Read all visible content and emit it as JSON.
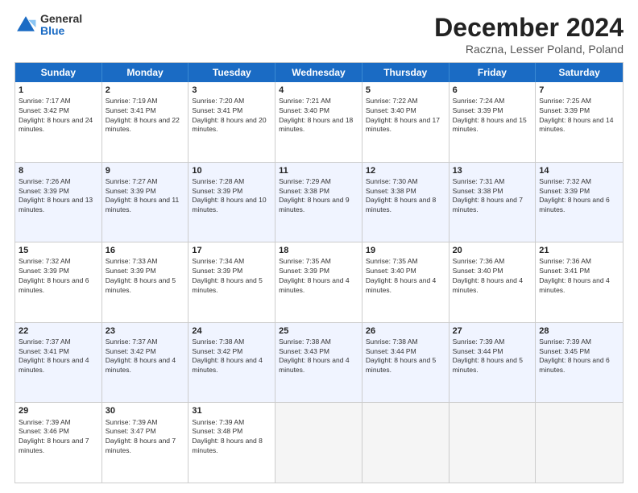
{
  "header": {
    "logo_general": "General",
    "logo_blue": "Blue",
    "main_title": "December 2024",
    "subtitle": "Raczna, Lesser Poland, Poland"
  },
  "calendar": {
    "days_of_week": [
      "Sunday",
      "Monday",
      "Tuesday",
      "Wednesday",
      "Thursday",
      "Friday",
      "Saturday"
    ],
    "rows": [
      [
        {
          "day": "1",
          "sunrise": "Sunrise: 7:17 AM",
          "sunset": "Sunset: 3:42 PM",
          "daylight": "Daylight: 8 hours and 24 minutes."
        },
        {
          "day": "2",
          "sunrise": "Sunrise: 7:19 AM",
          "sunset": "Sunset: 3:41 PM",
          "daylight": "Daylight: 8 hours and 22 minutes."
        },
        {
          "day": "3",
          "sunrise": "Sunrise: 7:20 AM",
          "sunset": "Sunset: 3:41 PM",
          "daylight": "Daylight: 8 hours and 20 minutes."
        },
        {
          "day": "4",
          "sunrise": "Sunrise: 7:21 AM",
          "sunset": "Sunset: 3:40 PM",
          "daylight": "Daylight: 8 hours and 18 minutes."
        },
        {
          "day": "5",
          "sunrise": "Sunrise: 7:22 AM",
          "sunset": "Sunset: 3:40 PM",
          "daylight": "Daylight: 8 hours and 17 minutes."
        },
        {
          "day": "6",
          "sunrise": "Sunrise: 7:24 AM",
          "sunset": "Sunset: 3:39 PM",
          "daylight": "Daylight: 8 hours and 15 minutes."
        },
        {
          "day": "7",
          "sunrise": "Sunrise: 7:25 AM",
          "sunset": "Sunset: 3:39 PM",
          "daylight": "Daylight: 8 hours and 14 minutes."
        }
      ],
      [
        {
          "day": "8",
          "sunrise": "Sunrise: 7:26 AM",
          "sunset": "Sunset: 3:39 PM",
          "daylight": "Daylight: 8 hours and 13 minutes."
        },
        {
          "day": "9",
          "sunrise": "Sunrise: 7:27 AM",
          "sunset": "Sunset: 3:39 PM",
          "daylight": "Daylight: 8 hours and 11 minutes."
        },
        {
          "day": "10",
          "sunrise": "Sunrise: 7:28 AM",
          "sunset": "Sunset: 3:39 PM",
          "daylight": "Daylight: 8 hours and 10 minutes."
        },
        {
          "day": "11",
          "sunrise": "Sunrise: 7:29 AM",
          "sunset": "Sunset: 3:38 PM",
          "daylight": "Daylight: 8 hours and 9 minutes."
        },
        {
          "day": "12",
          "sunrise": "Sunrise: 7:30 AM",
          "sunset": "Sunset: 3:38 PM",
          "daylight": "Daylight: 8 hours and 8 minutes."
        },
        {
          "day": "13",
          "sunrise": "Sunrise: 7:31 AM",
          "sunset": "Sunset: 3:38 PM",
          "daylight": "Daylight: 8 hours and 7 minutes."
        },
        {
          "day": "14",
          "sunrise": "Sunrise: 7:32 AM",
          "sunset": "Sunset: 3:39 PM",
          "daylight": "Daylight: 8 hours and 6 minutes."
        }
      ],
      [
        {
          "day": "15",
          "sunrise": "Sunrise: 7:32 AM",
          "sunset": "Sunset: 3:39 PM",
          "daylight": "Daylight: 8 hours and 6 minutes."
        },
        {
          "day": "16",
          "sunrise": "Sunrise: 7:33 AM",
          "sunset": "Sunset: 3:39 PM",
          "daylight": "Daylight: 8 hours and 5 minutes."
        },
        {
          "day": "17",
          "sunrise": "Sunrise: 7:34 AM",
          "sunset": "Sunset: 3:39 PM",
          "daylight": "Daylight: 8 hours and 5 minutes."
        },
        {
          "day": "18",
          "sunrise": "Sunrise: 7:35 AM",
          "sunset": "Sunset: 3:39 PM",
          "daylight": "Daylight: 8 hours and 4 minutes."
        },
        {
          "day": "19",
          "sunrise": "Sunrise: 7:35 AM",
          "sunset": "Sunset: 3:40 PM",
          "daylight": "Daylight: 8 hours and 4 minutes."
        },
        {
          "day": "20",
          "sunrise": "Sunrise: 7:36 AM",
          "sunset": "Sunset: 3:40 PM",
          "daylight": "Daylight: 8 hours and 4 minutes."
        },
        {
          "day": "21",
          "sunrise": "Sunrise: 7:36 AM",
          "sunset": "Sunset: 3:41 PM",
          "daylight": "Daylight: 8 hours and 4 minutes."
        }
      ],
      [
        {
          "day": "22",
          "sunrise": "Sunrise: 7:37 AM",
          "sunset": "Sunset: 3:41 PM",
          "daylight": "Daylight: 8 hours and 4 minutes."
        },
        {
          "day": "23",
          "sunrise": "Sunrise: 7:37 AM",
          "sunset": "Sunset: 3:42 PM",
          "daylight": "Daylight: 8 hours and 4 minutes."
        },
        {
          "day": "24",
          "sunrise": "Sunrise: 7:38 AM",
          "sunset": "Sunset: 3:42 PM",
          "daylight": "Daylight: 8 hours and 4 minutes."
        },
        {
          "day": "25",
          "sunrise": "Sunrise: 7:38 AM",
          "sunset": "Sunset: 3:43 PM",
          "daylight": "Daylight: 8 hours and 4 minutes."
        },
        {
          "day": "26",
          "sunrise": "Sunrise: 7:38 AM",
          "sunset": "Sunset: 3:44 PM",
          "daylight": "Daylight: 8 hours and 5 minutes."
        },
        {
          "day": "27",
          "sunrise": "Sunrise: 7:39 AM",
          "sunset": "Sunset: 3:44 PM",
          "daylight": "Daylight: 8 hours and 5 minutes."
        },
        {
          "day": "28",
          "sunrise": "Sunrise: 7:39 AM",
          "sunset": "Sunset: 3:45 PM",
          "daylight": "Daylight: 8 hours and 6 minutes."
        }
      ],
      [
        {
          "day": "29",
          "sunrise": "Sunrise: 7:39 AM",
          "sunset": "Sunset: 3:46 PM",
          "daylight": "Daylight: 8 hours and 7 minutes."
        },
        {
          "day": "30",
          "sunrise": "Sunrise: 7:39 AM",
          "sunset": "Sunset: 3:47 PM",
          "daylight": "Daylight: 8 hours and 7 minutes."
        },
        {
          "day": "31",
          "sunrise": "Sunrise: 7:39 AM",
          "sunset": "Sunset: 3:48 PM",
          "daylight": "Daylight: 8 hours and 8 minutes."
        },
        null,
        null,
        null,
        null
      ]
    ]
  }
}
